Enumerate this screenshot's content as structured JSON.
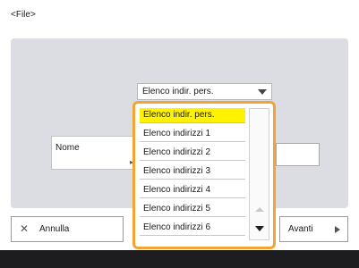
{
  "screen": {
    "title": "<File>"
  },
  "form": {
    "combo_value": "Elenco indir. pers.",
    "name_label": "Nome",
    "name_value": ""
  },
  "buttons": {
    "cancel": "Annulla",
    "next": "Avanti"
  },
  "dropdown": {
    "selected": "Elenco indir. pers.",
    "options": [
      "Elenco indir. pers.",
      "Elenco indirizzi 1",
      "Elenco indirizzi 2",
      "Elenco indirizzi 3",
      "Elenco indirizzi 4",
      "Elenco indirizzi 5",
      "Elenco indirizzi 6"
    ]
  },
  "colors": {
    "dropdown_border": "#f2a534",
    "selected_highlight": "#fff200",
    "panel": "#dcdde3",
    "bottom_bar": "#1d1d1f"
  },
  "icons": {
    "cancel": "close-icon",
    "next": "arrow-right-icon",
    "combo": "chevron-down-icon",
    "scroll_up": "scroll-up-icon",
    "scroll_down": "scroll-down-icon"
  }
}
